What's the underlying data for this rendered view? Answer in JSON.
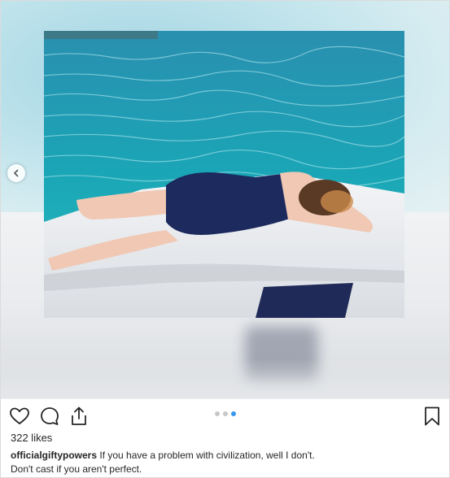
{
  "post": {
    "likes": "322 likes",
    "username": "officialgiftypowers",
    "caption_line1": "If you have a problem with civilization, well I don't.",
    "caption_line2": "Don't cast if you aren't perfect.",
    "carousel": {
      "total": 3,
      "active_index": 3
    }
  },
  "icons": {
    "like": "heart-outline-icon",
    "comment": "comment-bubble-icon",
    "share": "share-upload-icon",
    "save": "bookmark-icon",
    "prev": "chevron-left-icon"
  },
  "colors": {
    "dot_active": "#3897f0",
    "dot_inactive": "#c8c8c8",
    "text": "#262626"
  }
}
